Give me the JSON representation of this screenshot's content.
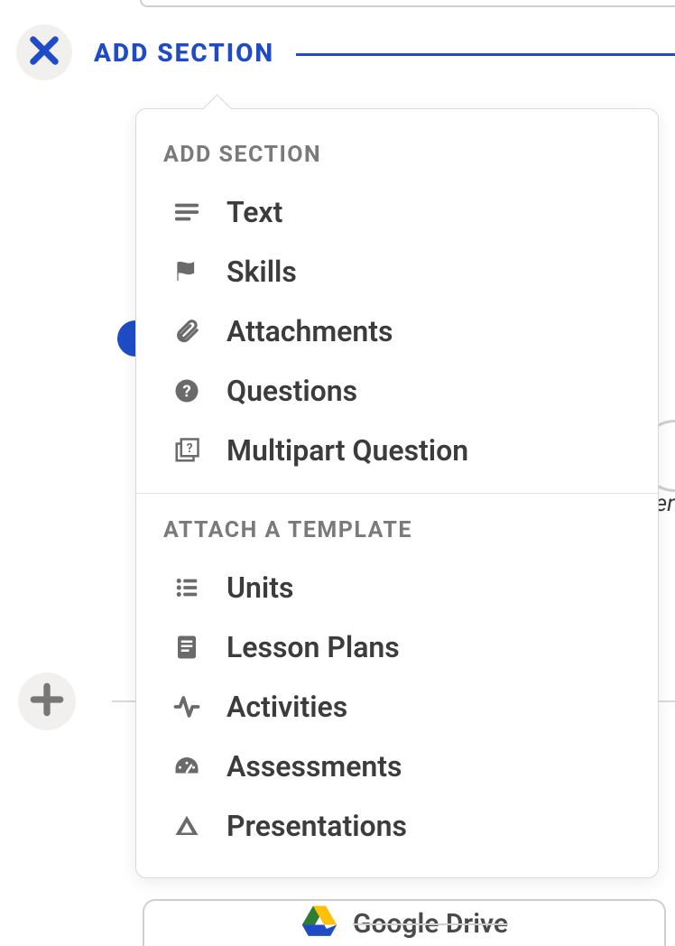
{
  "header": {
    "title": "ADD SECTION"
  },
  "background": {
    "em_text": "en",
    "gdrive_label": "Google Drive"
  },
  "popover": {
    "section1_heading": "ADD SECTION",
    "section2_heading": "ATTACH A TEMPLATE",
    "add_items": [
      {
        "id": "text",
        "label": "Text",
        "icon": "text-lines-icon"
      },
      {
        "id": "skills",
        "label": "Skills",
        "icon": "flag-icon"
      },
      {
        "id": "attachments",
        "label": "Attachments",
        "icon": "paperclip-icon"
      },
      {
        "id": "questions",
        "label": "Questions",
        "icon": "question-circle-icon"
      },
      {
        "id": "multipart",
        "label": "Multipart Question",
        "icon": "multipart-icon"
      }
    ],
    "template_items": [
      {
        "id": "units",
        "label": "Units",
        "icon": "list-icon"
      },
      {
        "id": "lesson-plans",
        "label": "Lesson Plans",
        "icon": "document-icon"
      },
      {
        "id": "activities",
        "label": "Activities",
        "icon": "activity-icon"
      },
      {
        "id": "assessments",
        "label": "Assessments",
        "icon": "gauge-icon"
      },
      {
        "id": "presentations",
        "label": "Presentations",
        "icon": "drive-triangle-icon"
      }
    ]
  }
}
